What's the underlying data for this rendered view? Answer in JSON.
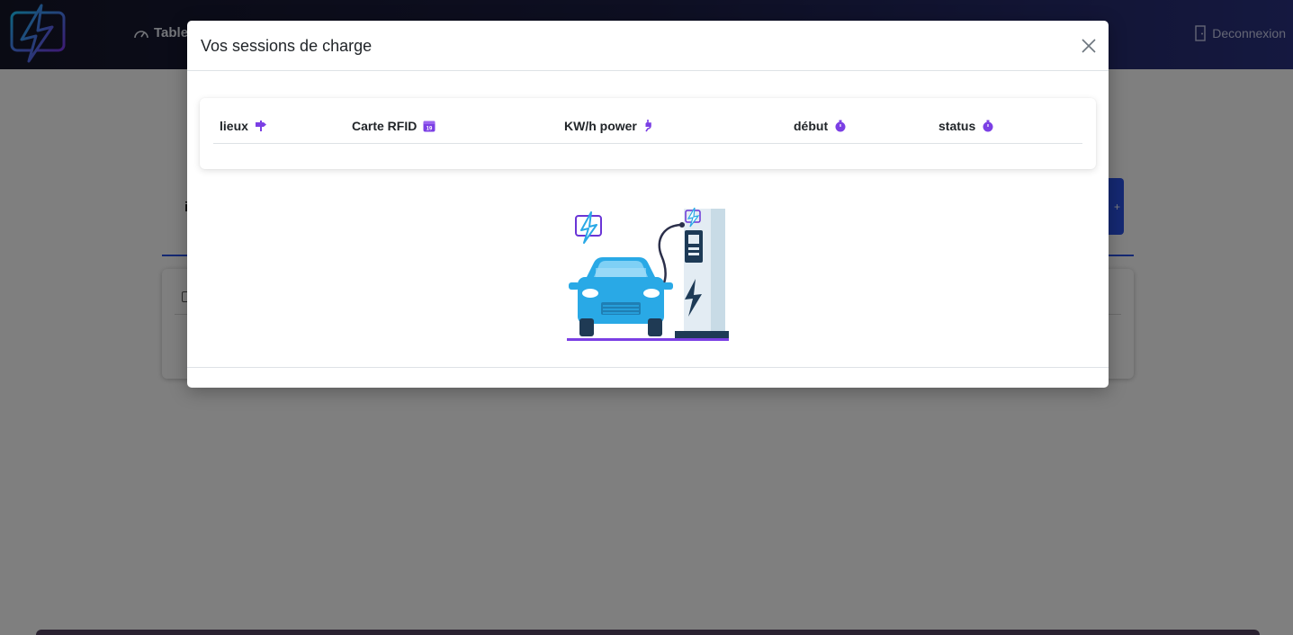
{
  "navbar": {
    "dashboard_label": "Table",
    "logout_label": "Deconnexion"
  },
  "background": {
    "partial_letter": "i",
    "button_glyph": "+"
  },
  "modal": {
    "title": "Vos sessions de charge",
    "close_icon": "close-icon",
    "table": {
      "columns": [
        {
          "label": "lieux",
          "icon": "signpost-icon"
        },
        {
          "label": "Carte RFID",
          "icon": "calendar-icon"
        },
        {
          "label": "KW/h power",
          "icon": "plug-icon"
        },
        {
          "label": "début",
          "icon": "stopwatch-icon"
        },
        {
          "label": "status",
          "icon": "stopwatch-icon"
        }
      ],
      "rows": []
    },
    "calendar_icon_day": "19"
  },
  "colors": {
    "accent_purple": "#7b3fe4",
    "car_blue": "#29a9e6",
    "navbar_dark": "#151629",
    "navbar_blue": "#2a3180",
    "primary_blue": "#2a52e6"
  }
}
